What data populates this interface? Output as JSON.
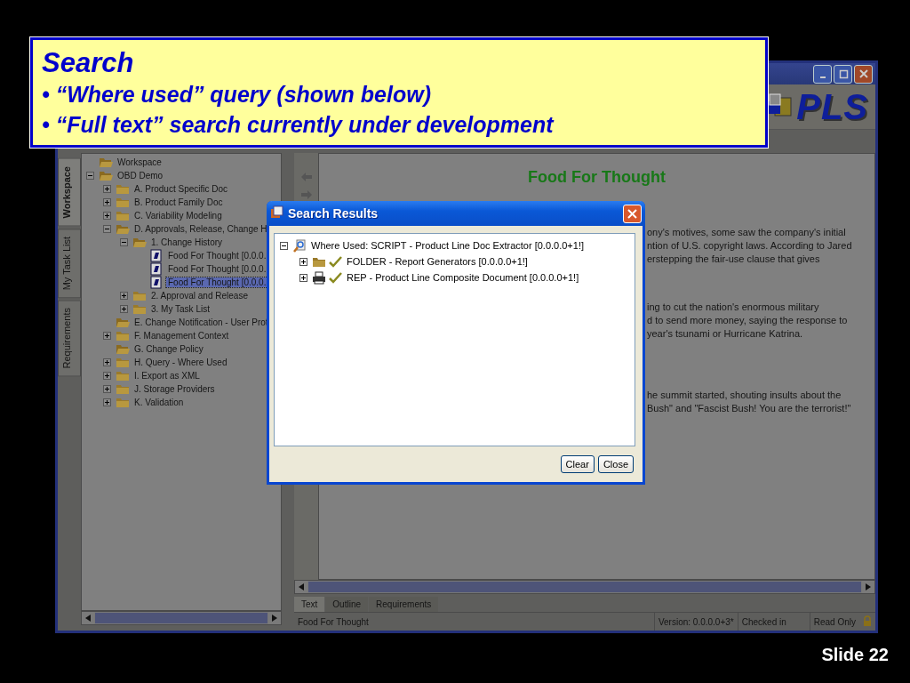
{
  "slide": {
    "heading": "Search",
    "bullets": [
      "• “Where used” query (shown below)",
      "• “Full text” search currently under development"
    ],
    "number": "Slide 22"
  },
  "app": {
    "logo": "PLS",
    "side_tabs": [
      {
        "label": "Workspace",
        "selected": true
      },
      {
        "label": "My Task List",
        "selected": false
      },
      {
        "label": "Requirements",
        "selected": false
      }
    ],
    "tree": [
      {
        "label": "Workspace",
        "kind": "folder",
        "toggle": false,
        "expanded": true,
        "selected": false
      },
      {
        "label": "OBD Demo",
        "kind": "folder",
        "toggle": true,
        "expanded": true,
        "selected": false,
        "children": [
          {
            "label": "A. Product Specific Doc",
            "kind": "folder",
            "toggle": true,
            "expanded": false,
            "selected": false
          },
          {
            "label": "B. Product Family Doc",
            "kind": "folder",
            "toggle": true,
            "expanded": false,
            "selected": false
          },
          {
            "label": "C. Variability Modeling",
            "kind": "folder",
            "toggle": true,
            "expanded": false,
            "selected": false
          },
          {
            "label": "D. Approvals, Release, Change H",
            "kind": "folder",
            "toggle": true,
            "expanded": true,
            "selected": false,
            "children": [
              {
                "label": "1. Change History",
                "kind": "folder",
                "toggle": true,
                "expanded": true,
                "selected": false,
                "children": [
                  {
                    "label": "Food For Thought [0.0.0.",
                    "kind": "document",
                    "toggle": false,
                    "expanded": false,
                    "selected": false
                  },
                  {
                    "label": "Food For Thought [0.0.0.",
                    "kind": "document",
                    "toggle": false,
                    "expanded": false,
                    "selected": false
                  },
                  {
                    "label": "Food For Thought [0.0.0.",
                    "kind": "document",
                    "toggle": false,
                    "expanded": false,
                    "selected": true
                  }
                ]
              },
              {
                "label": "2. Approval and Release",
                "kind": "folder",
                "toggle": true,
                "expanded": false,
                "selected": false
              },
              {
                "label": "3. My Task List",
                "kind": "folder",
                "toggle": true,
                "expanded": false,
                "selected": false
              }
            ]
          },
          {
            "label": "E. Change Notification - User Prot",
            "kind": "folder",
            "toggle": false,
            "expanded": true,
            "selected": false
          },
          {
            "label": "F. Management Context",
            "kind": "folder",
            "toggle": true,
            "expanded": false,
            "selected": false
          },
          {
            "label": "G. Change Policy",
            "kind": "folder",
            "toggle": false,
            "expanded": true,
            "selected": false
          },
          {
            "label": "H. Query - Where Used",
            "kind": "folder",
            "toggle": true,
            "expanded": false,
            "selected": false
          },
          {
            "label": "I. Export as XML",
            "kind": "folder",
            "toggle": true,
            "expanded": false,
            "selected": false
          },
          {
            "label": "J. Storage Providers",
            "kind": "folder",
            "toggle": true,
            "expanded": false,
            "selected": false
          },
          {
            "label": "K. Validation",
            "kind": "folder",
            "toggle": true,
            "expanded": false,
            "selected": false
          }
        ]
      }
    ],
    "document": {
      "title": "Food For Thought",
      "paragraphs": [
        [
          "ony's motives, some saw the company's initial",
          "ntion of U.S. copyright laws. According to Jared",
          "erstepping the fair-use clause that gives"
        ],
        [
          "ing to cut the nation's enormous military",
          "d to send more money, saying the response to",
          "year's tsunami or Hurricane Katrina."
        ],
        [
          "he summit started, shouting insults about the",
          "Bush\" and \"Fascist Bush! You are the terrorist!\""
        ]
      ]
    },
    "doc_tabs": [
      {
        "label": "Text",
        "selected": true
      },
      {
        "label": "Outline",
        "selected": false
      },
      {
        "label": "Requirements",
        "selected": false
      }
    ],
    "status_bar": {
      "title": "Food For Thought",
      "version": "Version: 0.0.0.0+3*",
      "state": "Checked in",
      "access": "Read Only",
      "locked": true
    }
  },
  "dialog": {
    "title": "Search Results",
    "results": [
      {
        "label": "Where Used: SCRIPT - Product Line Doc Extractor [0.0.0.0+1!]",
        "kind": "query",
        "toggle": true,
        "expanded": true,
        "checked": false,
        "children": [
          {
            "label": "FOLDER - Report Generators [0.0.0.0+1!]",
            "kind": "folder",
            "toggle": true,
            "expanded": false,
            "checked": true
          },
          {
            "label": "REP - Product Line Composite Document [0.0.0.0+1!]",
            "kind": "printer",
            "toggle": true,
            "expanded": false,
            "checked": true
          }
        ]
      }
    ],
    "buttons": [
      "Clear",
      "Close"
    ]
  }
}
